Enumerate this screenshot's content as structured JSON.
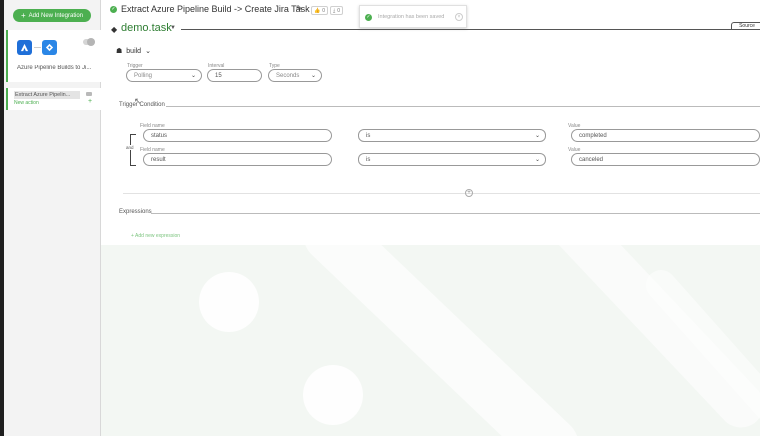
{
  "sidebar": {
    "add_button": "Add New Integration",
    "integration_title": "Azure Pipeline Builds to Ji...",
    "step_label": "Extract Azure Pipelin...",
    "new_action": "New action"
  },
  "header": {
    "title": "Extract Azure Pipeline Build -> Create Jira Task",
    "likes": "0",
    "downloads": "0",
    "toast": "Integration has been saved",
    "source_tab": "Source",
    "task_name": "demo.task"
  },
  "build": {
    "label": "build",
    "trigger_label": "Trigger",
    "trigger_value": "Polling",
    "interval_label": "Interval",
    "interval_value": "15",
    "type_label": "Type",
    "type_value": "Seconds"
  },
  "trigger_condition": {
    "label": "Trigger Condition",
    "operator": "and",
    "rows": [
      {
        "field_label": "Field name",
        "field": "status",
        "op": "is",
        "value_label": "Value",
        "value": "completed"
      },
      {
        "field_label": "Field name",
        "field": "result",
        "op": "is",
        "value_label": "Value",
        "value": "canceled"
      }
    ]
  },
  "expressions": {
    "label": "Expressions",
    "add_label": "+ Add new expression"
  },
  "colors": {
    "accent": "#4caf50",
    "task_name": "#2e7d32",
    "jira_blue": "#2a86e6"
  }
}
